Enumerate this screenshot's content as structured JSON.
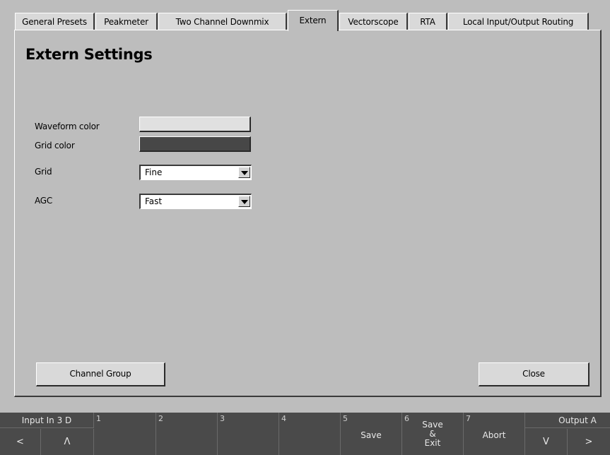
{
  "tabs": [
    {
      "label": "General Presets",
      "active": false
    },
    {
      "label": "Peakmeter",
      "active": false
    },
    {
      "label": "Two Channel Downmix",
      "active": false
    },
    {
      "label": "Extern",
      "active": true
    },
    {
      "label": "Vectorscope",
      "active": false
    },
    {
      "label": "RTA",
      "active": false
    },
    {
      "label": "Local Input/Output Routing",
      "active": false
    }
  ],
  "panel": {
    "title": "Extern Settings",
    "waveform_color": {
      "label": "Waveform color",
      "color": "#e0e0e0"
    },
    "grid_color": {
      "label": "Grid color",
      "color": "#474747"
    },
    "grid": {
      "label": "Grid",
      "value": "Fine"
    },
    "agc": {
      "label": "AGC",
      "value": "Fast"
    },
    "channel_group_button": "Channel Group",
    "close_button": "Close"
  },
  "softkeys": {
    "input": {
      "title": "Input In 3 D",
      "left": "<",
      "up": "Λ"
    },
    "keys": [
      {
        "num": "1",
        "label": ""
      },
      {
        "num": "2",
        "label": ""
      },
      {
        "num": "3",
        "label": ""
      },
      {
        "num": "4",
        "label": ""
      },
      {
        "num": "5",
        "label": "Save"
      },
      {
        "num": "6",
        "label_lines": [
          "Save",
          "&",
          "Exit"
        ]
      },
      {
        "num": "7",
        "label": "Abort"
      }
    ],
    "output": {
      "title": "Output A",
      "down": "V",
      "right": ">"
    }
  }
}
